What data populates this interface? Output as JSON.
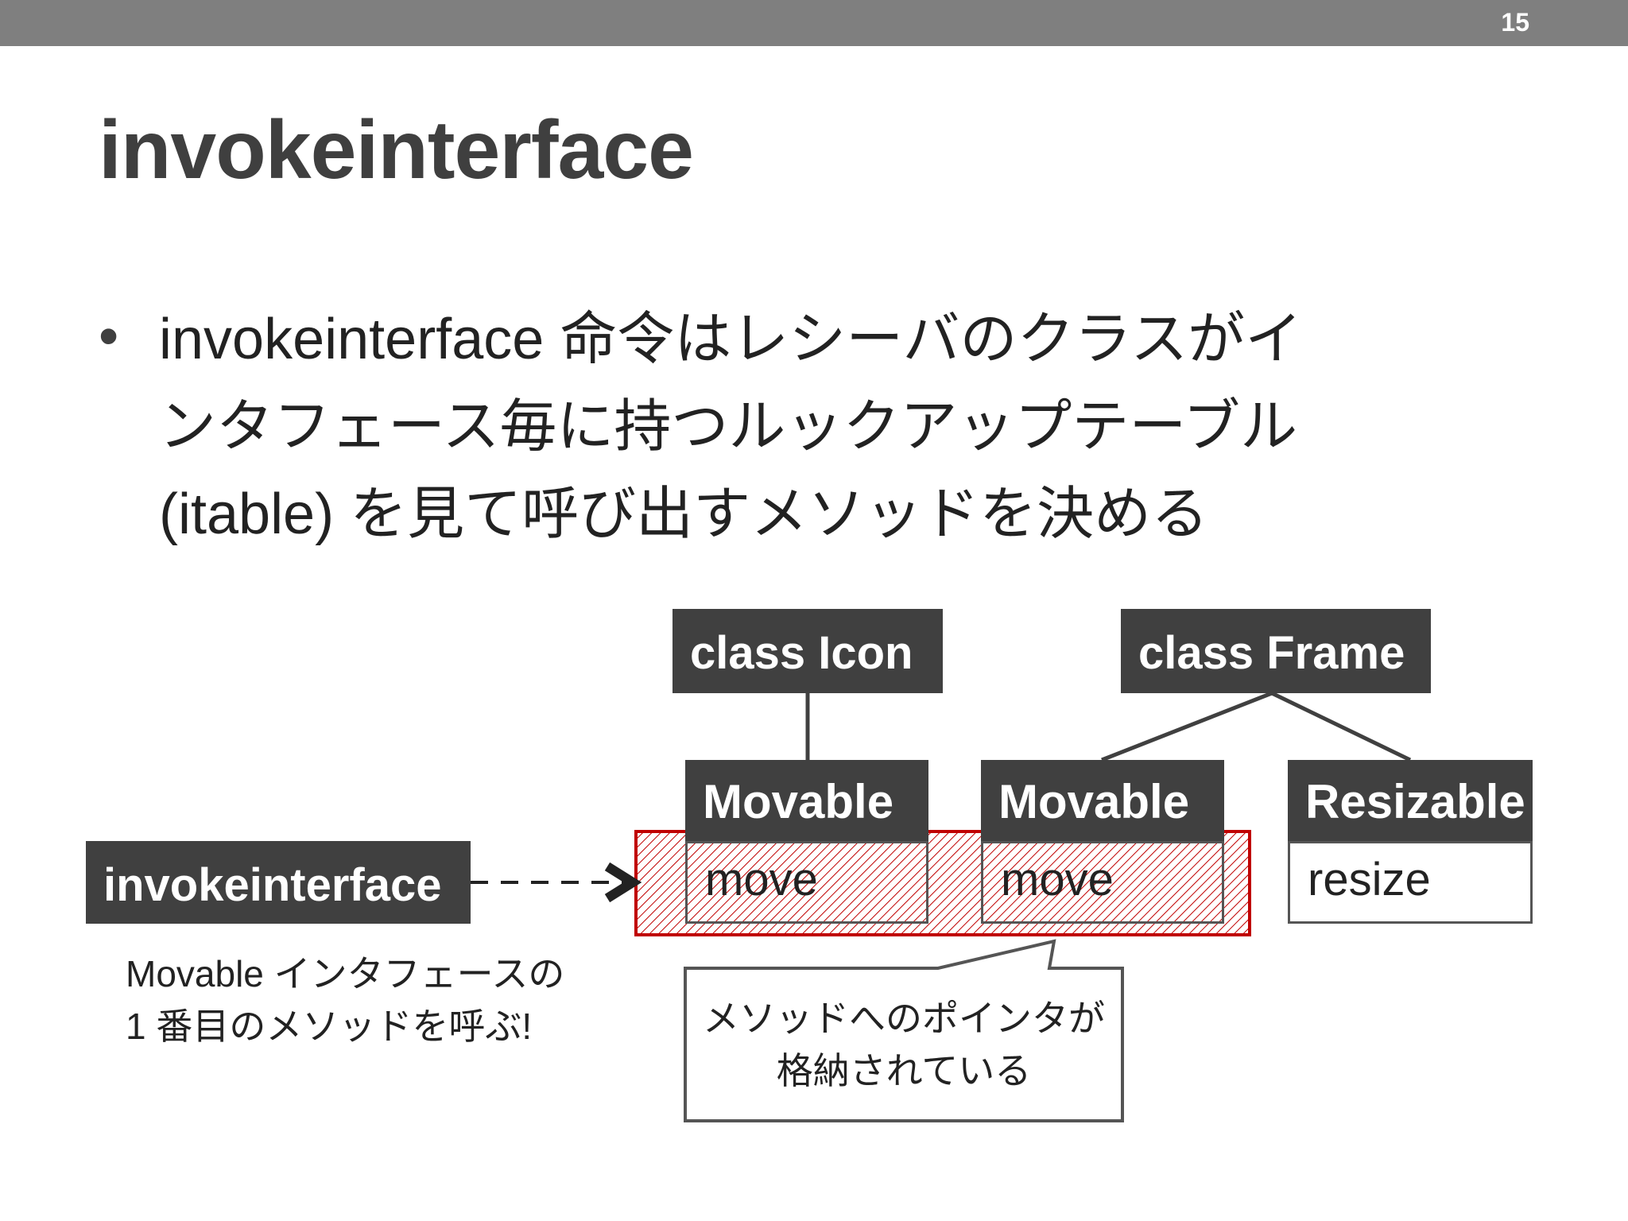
{
  "page_number": "15",
  "title": "invokeinterface",
  "bullet": {
    "lines": [
      "invokeinterface 命令はレシーバのクラスがイ",
      "ンタフェース毎に持つルックアップテーブル",
      "(itable) を見て呼び出すメソッドを決める"
    ]
  },
  "diagram": {
    "class_icon": "class Icon",
    "class_frame": "class Frame",
    "interfaces": [
      {
        "name": "Movable",
        "method": "move"
      },
      {
        "name": "Movable",
        "method": "move"
      },
      {
        "name": "Resizable",
        "method": "resize"
      }
    ],
    "instruction": "invokeinterface",
    "caption_left": [
      "Movable インタフェースの",
      "1 番目のメソッドを呼ぶ!"
    ],
    "callout": [
      "メソッドへのポインタが",
      "格納されている"
    ],
    "colors": {
      "box_dark": "#404040",
      "highlight_border": "#c00000",
      "topbar": "#7f7f7f"
    }
  }
}
